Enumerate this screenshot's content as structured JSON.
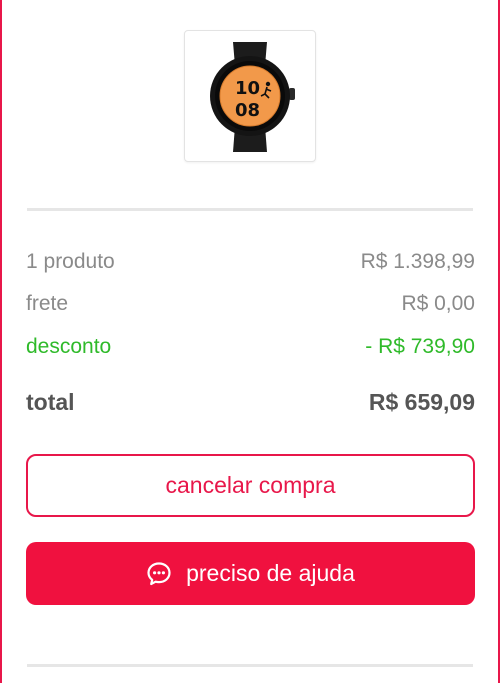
{
  "product": {
    "image_icon": "smartwatch-image",
    "watch_face_text": "10 08"
  },
  "summary": {
    "products_label": "1 produto",
    "products_value": "R$ 1.398,99",
    "shipping_label": "frete",
    "shipping_value": "R$ 0,00",
    "discount_label": "desconto",
    "discount_value": "- R$ 739,90",
    "total_label": "total",
    "total_value": "R$ 659,09"
  },
  "actions": {
    "cancel_label": "cancelar compra",
    "help_label": "preciso de ajuda",
    "help_icon": "chat-bubble-icon"
  },
  "colors": {
    "accent": "#e8174a",
    "discount": "#2fba2a",
    "muted_text": "#8a8a8a",
    "total_text": "#555555"
  }
}
